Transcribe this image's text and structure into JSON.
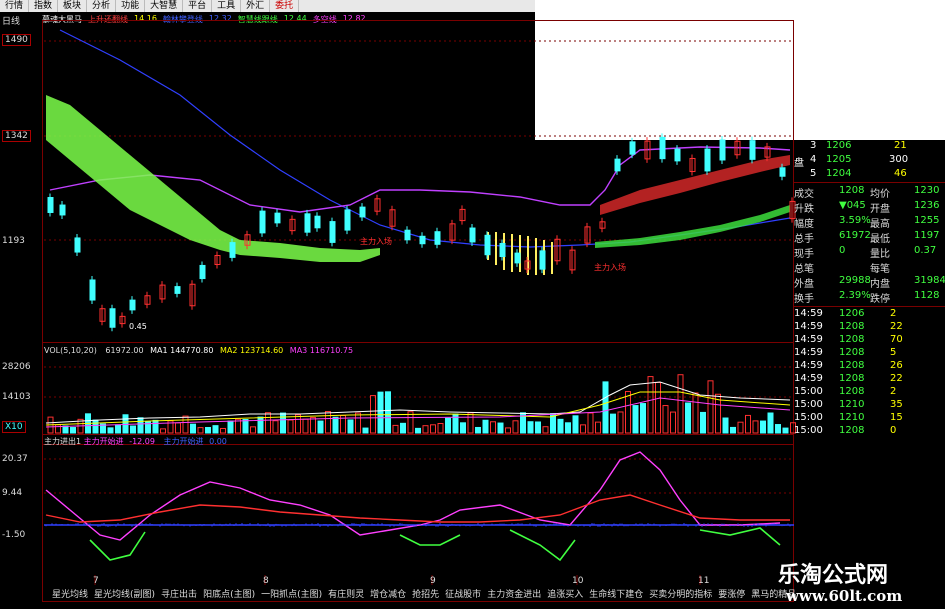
{
  "menu": [
    "行情",
    "指数",
    "板块",
    "分析",
    "功能",
    "大智慧",
    "平台",
    "工具",
    "外汇",
    "委托"
  ],
  "timeframe": "日线",
  "main_indicators": [
    {
      "label": "慕魂大黑马",
      "color": "#ffffff"
    },
    {
      "label": "上升还翻线",
      "color": "#ff4040"
    },
    {
      "label": "14.16",
      "color": "#ffff00"
    },
    {
      "label": "翰林攀登线",
      "color": "#2040ff"
    },
    {
      "label": "12.32",
      "color": "#2040ff"
    },
    {
      "label": "智慧线跟线",
      "color": "#40ff40"
    },
    {
      "label": "12.44",
      "color": "#40ff40"
    },
    {
      "label": "多空线",
      "color": "#ff40ff"
    },
    {
      "label": "12.82",
      "color": "#ff40ff"
    }
  ],
  "price_axis": [
    "1490",
    "1342",
    "1193"
  ],
  "annotations": {
    "low": "0.45",
    "entry1": "主力入场",
    "entry2": "主力入场"
  },
  "vol_header": {
    "label": "VOL(5,10,20)",
    "v": "61972.00",
    "ma1_label": "MA1",
    "ma1": "144770.80",
    "ma2_label": "MA2",
    "ma2": "123714.60",
    "ma3_label": "MA3",
    "ma3": "116710.75"
  },
  "vol_axis": [
    "28206",
    "14103",
    "X10"
  ],
  "flow_header": {
    "label": "主力进出1",
    "a_label": "主力开始进",
    "a": "-12.09",
    "b_label": "主力开始进",
    "b": "0.00"
  },
  "flow_axis": [
    "20.37",
    "9.44",
    "-1.50"
  ],
  "x_dates": [
    "7",
    "8",
    "9",
    "10",
    "11"
  ],
  "tabs": [
    "星光均线",
    "星光均线(副图)",
    "寻庄出击",
    "阳底点(主图)",
    "一阳抓点(主图)",
    "有庄则灵",
    "增仓减仓",
    "抢招先",
    "征战股市",
    "主力资金进出",
    "追涨买入",
    "生命线下建仓",
    "买卖分明的指标",
    "要涨停",
    "黑马的精品"
  ],
  "order_book": {
    "rows": [
      {
        "n": "3",
        "price": "1206",
        "vol": "21"
      },
      {
        "n": "4",
        "price": "1205",
        "vol": "300"
      },
      {
        "n": "5",
        "price": "1204",
        "vol": "46"
      }
    ],
    "side_label": "盘"
  },
  "quote": [
    {
      "k1": "成交",
      "v1": "1208",
      "k2": "均价",
      "v2": "1230"
    },
    {
      "k1": "升跌",
      "v1": "▼045",
      "k2": "开盘",
      "v2": "1236"
    },
    {
      "k1": "幅度",
      "v1": "3.59%",
      "k2": "最高",
      "v2": "1255"
    },
    {
      "k1": "总手",
      "v1": "61972",
      "k2": "最低",
      "v2": "1197"
    },
    {
      "k1": "现手",
      "v1": "0",
      "k2": "量比",
      "v2": "0.37"
    },
    {
      "k1": "总笔",
      "v1": "",
      "k2": "每笔",
      "v2": ""
    },
    {
      "k1": "外盘",
      "v1": "29988",
      "k2": "内盘",
      "v2": "31984"
    },
    {
      "k1": "换手",
      "v1": "2.39%",
      "k2": "跌停",
      "v2": "1128"
    }
  ],
  "ticks": [
    {
      "t": "14:59",
      "p": "1206",
      "v": "2"
    },
    {
      "t": "14:59",
      "p": "1208",
      "v": "22"
    },
    {
      "t": "14:59",
      "p": "1208",
      "v": "70"
    },
    {
      "t": "14:59",
      "p": "1208",
      "v": "5"
    },
    {
      "t": "14:59",
      "p": "1208",
      "v": "26"
    },
    {
      "t": "14:59",
      "p": "1208",
      "v": "22"
    },
    {
      "t": "15:00",
      "p": "1208",
      "v": "2"
    },
    {
      "t": "15:00",
      "p": "1210",
      "v": "35"
    },
    {
      "t": "15:00",
      "p": "1210",
      "v": "15"
    },
    {
      "t": "15:00",
      "p": "1208",
      "v": "0"
    }
  ],
  "watermark": {
    "line1": "乐淘公式网",
    "line2": "www.60lt.com"
  }
}
